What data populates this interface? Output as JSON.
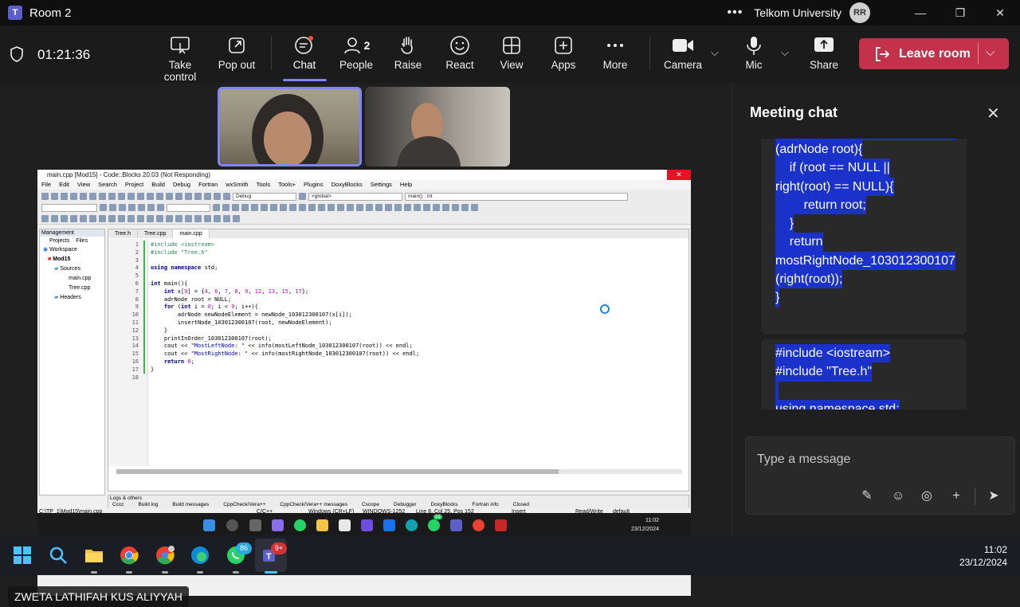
{
  "titlebar": {
    "room": "Room 2",
    "more": "•••",
    "org": "Telkom University",
    "avatar": "RR",
    "minimize": "—",
    "restore": "❐",
    "close": "✕"
  },
  "toolbar": {
    "timer": "01:21:36",
    "items": [
      {
        "label": "Take control",
        "icon": "take-control-icon"
      },
      {
        "label": "Pop out",
        "icon": "pop-out-icon"
      },
      {
        "label": "Chat",
        "icon": "chat-icon"
      },
      {
        "label": "People",
        "icon": "people-icon",
        "count": "2"
      },
      {
        "label": "Raise",
        "icon": "hand-icon"
      },
      {
        "label": "React",
        "icon": "smile-icon"
      },
      {
        "label": "View",
        "icon": "grid-icon"
      },
      {
        "label": "Apps",
        "icon": "plus-box-icon"
      },
      {
        "label": "More",
        "icon": "more-icon"
      },
      {
        "label": "Camera",
        "icon": "camera-icon"
      },
      {
        "label": "Mic",
        "icon": "mic-icon"
      },
      {
        "label": "Share",
        "icon": "share-icon"
      }
    ],
    "leave": "Leave room",
    "accent": "#c4314b",
    "active": "#7f85f5"
  },
  "shared_screen": {
    "window_title": "main.cpp [Mod15] - Code::Blocks 20.03 (Not Responding)",
    "menu": [
      "File",
      "Edit",
      "View",
      "Search",
      "Project",
      "Build",
      "Debug",
      "Fortran",
      "wxSmith",
      "Tools",
      "Tools+",
      "Plugins",
      "DoxyBlocks",
      "Settings",
      "Help"
    ],
    "build_target": "Debug",
    "scope": "<global>",
    "symbol": "main() : int",
    "management": {
      "title": "Management",
      "tabs": [
        "Projects",
        "Files"
      ],
      "tree": [
        "Workspace",
        "Mod15",
        "Sources",
        "main.cpp",
        "Tree.cpp",
        "Headers"
      ]
    },
    "tabs": [
      "Tree.h",
      "Tree.cpp",
      "main.cpp"
    ],
    "code": [
      "#include <iostream>",
      "#include \"Tree.h\"",
      "",
      "using namespace std;",
      "",
      "int main(){",
      "    int x[9] = {4, 6, 7, 8, 9, 12, 13, 15, 17};",
      "    adrNode root = NULL;",
      "    for (int i = 0; i < 9; i++){",
      "        adrNode newNodeElement = newNode_103012300107(x[i]);",
      "        insertNode_103012300107(root, newNodeElement);",
      "    }",
      "    printInOrder_103012300107(root);",
      "    cout << \"MostLeftNode: \" << info(mostLeftNode_103012300107(root)) << endl;",
      "    cout << \"MostRightNode: \" << info(mostRightNode_103012300107(root)) << endl;",
      "    return 0;",
      "}",
      ""
    ],
    "logs_title": "Logs & others",
    "log_tabs": [
      "Cccc",
      "Build log",
      "Build messages",
      "CppCheck/Vera++",
      "CppCheck/Vera++ messages",
      "Cscope",
      "Debugger",
      "DoxyBlocks",
      "Fortran info",
      "Closed"
    ],
    "status": {
      "path": "C:\\TP_1\\Mod15\\main.cpp",
      "lang": "C/C++",
      "eol": "Windows (CR+LF)",
      "enc": "WINDOWS-1252",
      "pos": "Line 8, Col 25, Pos 152",
      "mode": "Insert",
      "rw": "Read/Write",
      "profile": "default"
    },
    "tray_time": "11:02",
    "tray_date": "23/12/2024",
    "badge_teams": "12"
  },
  "participant_name": "ZWETA LATHIFAH KUS ALIYYAH",
  "chat": {
    "title": "Meeting chat",
    "message1_lines": [
      "(adrNode root){",
      "    if (root == NULL ||",
      "right(root) == NULL){",
      "        return root;",
      "    }",
      "    return",
      "mostRightNode_103012300107",
      "(right(root));",
      "}"
    ],
    "message2_lines": [
      "#include <iostream>",
      "#include \"Tree.h\"",
      "",
      "using namespace std;"
    ],
    "placeholder": "Type a message",
    "selection_color": "#1a32c9"
  },
  "taskbar": {
    "time": "11:02",
    "date": "23/12/2024",
    "whatsapp_badge": "86",
    "teams_badge": "9+"
  }
}
